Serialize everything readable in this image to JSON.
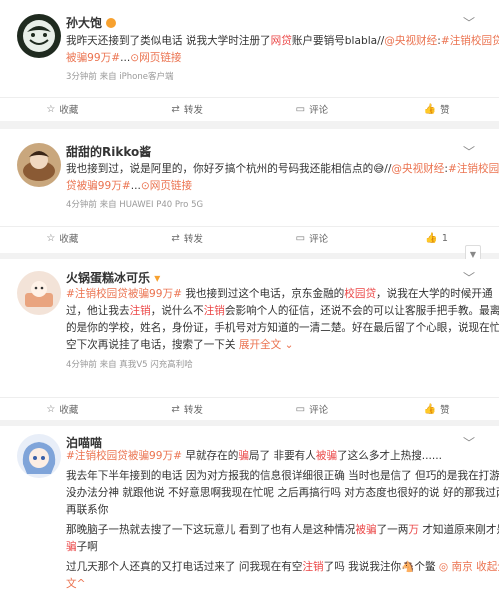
{
  "posts": [
    {
      "user": "孙大饱",
      "line1_a": "我昨天还接到了类似电话 说我大学时注册了",
      "line1_b": "网贷",
      "line1_c": "账户要销号blabla//",
      "line1_d": "@央视财经",
      "line1_e": ":",
      "line1_f": "#注销校园贷",
      "line2_a": "被骗99万#",
      "line2_b": "...",
      "line2_c": "网页链接",
      "meta": "3分钟前 来自 iPhone客户端",
      "actions": [
        "收藏",
        "转发",
        "评论",
        "赞"
      ]
    },
    {
      "user": "甜甜的Rikko酱",
      "line1_a": "我也接到过，说是阿里的，你好歹搞个杭州的号码我还能相信点的",
      "line1_b": "//",
      "line1_c": "@央视财经",
      "line1_d": ":",
      "line1_e": "#注销校园",
      "line2_a": "贷被骗99万#",
      "line2_b": "...",
      "line2_c": "网页链接",
      "meta": "4分钟前 来自 HUAWEI P40 Pro 5G",
      "actions": [
        "收藏",
        "转发",
        "评论",
        "1"
      ]
    },
    {
      "user": "火锅蛋糕冰可乐",
      "line1_a": "#注销校园贷被骗99万#",
      "line1_b": " 我也接到过这个电话，京东金融的",
      "line1_c": "校园贷",
      "line1_d": "，说我在大学的时候开通",
      "line2_a": "过，他让我去",
      "line2_b": "注销",
      "line2_c": "，说什么不",
      "line2_d": "注销",
      "line2_e": "会影响个人的征信，还说不会的可以让客服手把手教。最离谱",
      "line3": "的是你的学校，姓名，身份证，手机号对方知道的一清二楚。好在最后留了个心眼，说现在忙没",
      "line4_a": "空下次再说挂了电话，搜索了一下关",
      "line4_b": "展开全文",
      "meta": "4分钟前 来自 真我V5 闪充高利哈",
      "actions": [
        "收藏",
        "转发",
        "评论",
        "赞"
      ]
    },
    {
      "user": "泊喵喵",
      "line1_a": "#注销校园贷被骗99万#",
      "line1_b": " 早就存在的",
      "line1_c": "骗",
      "line1_d": "局了 非要有人",
      "line1_e": "被骗",
      "line1_f": "了这么多才上热搜......",
      "line2": "我去年下半年接到的电话 因为对方报我的信息很详细很正确 当时也是信了 但巧的是我在打游戏",
      "line3": "没办法分神 就跟他说 不好意思啊我现在忙呢 之后再搞行吗 对方态度也很好的说 好的那我过两天",
      "line4": "再联系你",
      "line5_a": "那晚脑子一热就去搜了一下这玩意儿 看到了也有人是这种情况",
      "line5_b": "被骗",
      "line5_c": "了一两",
      "line5_d": "万",
      "line5_e": " 才知道原来刚才是个",
      "line6_a": "骗",
      "line6_b": "子啊",
      "line7_a": "过几天那个人还真的又打电话过来了 问我现在有空",
      "line7_b": "注销",
      "line7_c": "了吗 我说我注你",
      "line7_d": "🐴",
      "line7_e": "个鳖 ",
      "line7_f": "◎ 南京",
      "line7_g": " 收起全",
      "line8": "文^"
    }
  ],
  "colors": {
    "link": "#eb7350",
    "red": "#eb4747",
    "text": "#333333",
    "meta": "#999999"
  }
}
